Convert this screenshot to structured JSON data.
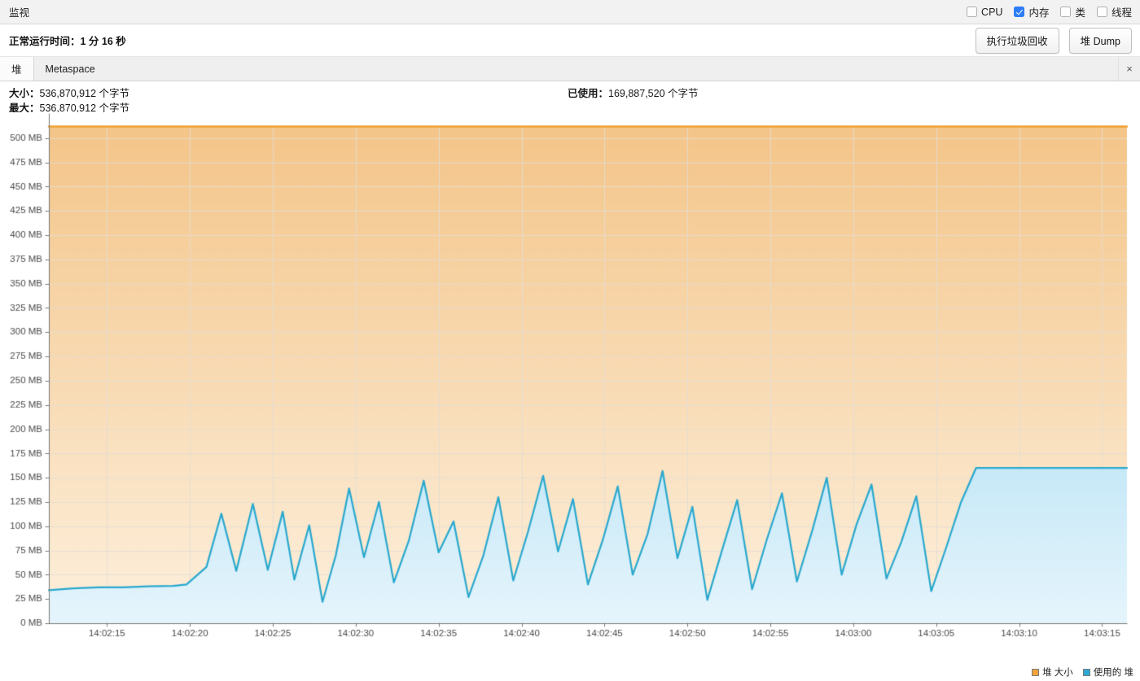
{
  "titlebar": {
    "title": "监视",
    "checkboxes": [
      {
        "label": "CPU",
        "checked": false
      },
      {
        "label": "内存",
        "checked": true
      },
      {
        "label": "类",
        "checked": false
      },
      {
        "label": "线程",
        "checked": false
      }
    ]
  },
  "toolbar": {
    "uptime_label": "正常运行时间：1 分 16 秒",
    "gc_button": "执行垃圾回收",
    "heapdump_button": "堆 Dump"
  },
  "tabs": {
    "items": [
      {
        "label": "堆",
        "active": true
      },
      {
        "label": "Metaspace",
        "active": false
      }
    ],
    "close_icon": "×"
  },
  "stats": {
    "size_label": "大小：",
    "size_value": "536,870,912 个字节",
    "max_label": "最大：",
    "max_value": "536,870,912 个字节",
    "used_label": "已使用：",
    "used_value": "169,887,520 个字节"
  },
  "legend": {
    "items": [
      {
        "label": "堆 大小",
        "color": "#f0a33c"
      },
      {
        "label": "使用的 堆",
        "color": "#2fa8d4"
      }
    ]
  },
  "colors": {
    "heap_size_line": "#f0a030",
    "heap_size_fill_top": "#f4c589",
    "heap_size_fill_bottom": "#fdf0dd",
    "heap_used_line": "#29a8ce",
    "heap_used_fill_top": "#c5e8f7",
    "heap_used_fill_bottom": "#e6f5fc",
    "grid": "#e3ddd4",
    "axis_text": "#4a4a4a",
    "accent_checkbox": "#2e7df6"
  },
  "chart_data": {
    "type": "area",
    "title": "",
    "xlabel": "",
    "ylabel": "",
    "grid": true,
    "legend_position": "bottom-right",
    "ylim": [
      0,
      525
    ],
    "ytick_step": 25,
    "ytick_labels": [
      "0 MB",
      "25 MB",
      "50 MB",
      "75 MB",
      "100 MB",
      "125 MB",
      "150 MB",
      "175 MB",
      "200 MB",
      "225 MB",
      "250 MB",
      "275 MB",
      "300 MB",
      "325 MB",
      "350 MB",
      "375 MB",
      "400 MB",
      "425 MB",
      "450 MB",
      "475 MB",
      "500 MB"
    ],
    "ytick_values": [
      0,
      25,
      50,
      75,
      100,
      125,
      150,
      175,
      200,
      225,
      250,
      275,
      300,
      325,
      350,
      375,
      400,
      425,
      450,
      475,
      500
    ],
    "xtick_labels": [
      "14:02:15",
      "14:02:20",
      "14:02:25",
      "14:02:30",
      "14:02:35",
      "14:02:40",
      "14:02:45",
      "14:02:50",
      "14:02:55",
      "14:03:00",
      "14:03:05",
      "14:03:10",
      "14:03:15"
    ],
    "xtick_values": [
      135,
      140,
      145,
      150,
      155,
      160,
      165,
      170,
      175,
      180,
      185,
      190,
      195
    ],
    "xlim": [
      131.5,
      196.5
    ],
    "series": [
      {
        "name": "堆 大小",
        "color": "#f0a030",
        "fill": true,
        "x": [
          131.5,
          196.5
        ],
        "values": [
          512,
          512
        ]
      },
      {
        "name": "使用的 堆",
        "color": "#29a8ce",
        "fill": true,
        "x": [
          131.5,
          133,
          134.5,
          136,
          137.5,
          139,
          139.8,
          141,
          141.9,
          142.8,
          143.8,
          144.7,
          145.6,
          146.3,
          147.2,
          148.0,
          148.8,
          149.6,
          150.5,
          151.4,
          152.3,
          153.2,
          154.1,
          155.0,
          155.9,
          156.8,
          157.7,
          158.6,
          159.5,
          160.4,
          161.3,
          162.2,
          163.1,
          164.0,
          164.9,
          165.8,
          166.7,
          167.6,
          168.5,
          169.4,
          170.3,
          171.2,
          172.1,
          173.0,
          173.9,
          174.8,
          175.7,
          176.6,
          177.5,
          178.4,
          179.3,
          180.2,
          181.1,
          182.0,
          182.9,
          183.8,
          184.7,
          185.6,
          186.5,
          187.4,
          188.3,
          189.2,
          190.1,
          191.0,
          191.8,
          192.6,
          194,
          195.2,
          196.5
        ],
        "values": [
          34,
          36,
          37,
          37,
          38,
          38.5,
          40,
          58,
          113,
          54,
          123,
          55,
          115,
          45,
          101,
          22,
          70,
          139,
          68,
          125,
          42,
          85,
          147,
          73,
          105,
          27,
          70,
          130,
          44,
          95,
          152,
          74,
          128,
          40,
          86,
          141,
          50,
          92,
          157,
          67,
          120,
          24,
          76,
          127,
          35,
          87,
          134,
          43,
          94,
          150,
          50,
          102,
          143,
          46,
          84,
          131,
          33,
          78,
          125,
          160,
          160,
          160,
          160,
          160,
          160,
          160,
          160,
          160,
          160
        ]
      }
    ]
  }
}
